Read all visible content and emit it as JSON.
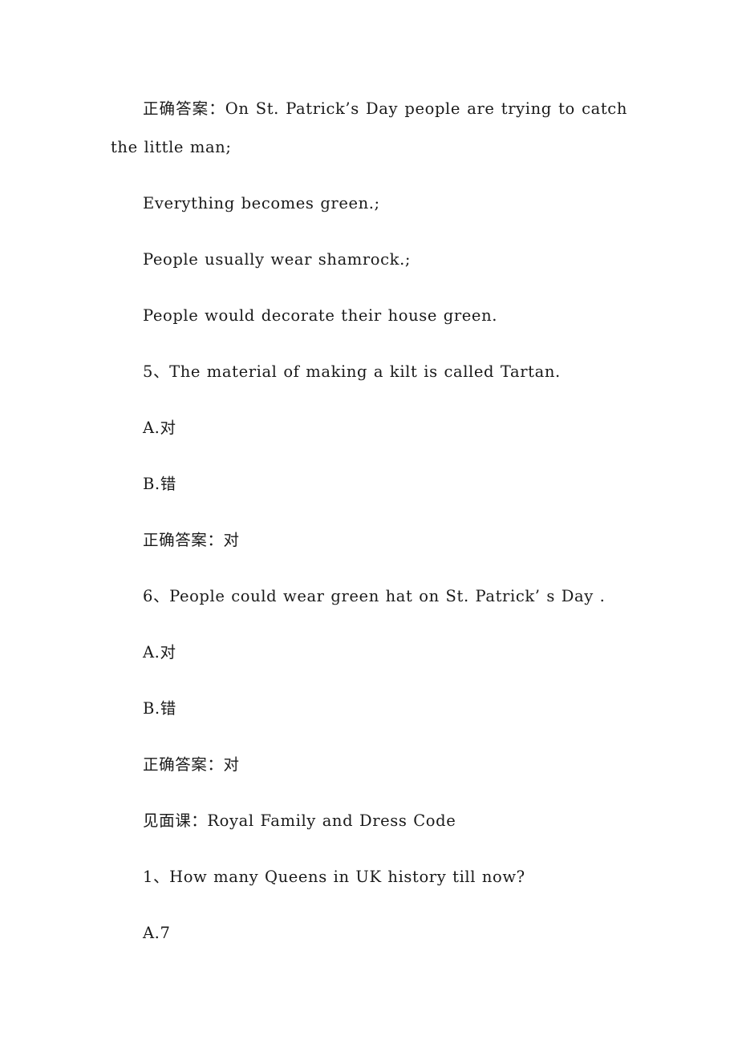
{
  "document": {
    "background_color": "#ffffff",
    "text_color": "#1a1a1a",
    "blocks": [
      {
        "id": "answer-4",
        "kind": "correct-answer",
        "text": "正确答案：On St. Patrick’s Day people are trying to catch the little man;"
      },
      {
        "id": "answer-4-line-2",
        "kind": "correct-answer-continuation",
        "text": "Everything becomes green.;"
      },
      {
        "id": "answer-4-line-3",
        "kind": "correct-answer-continuation",
        "text": "People usually wear shamrock.;"
      },
      {
        "id": "answer-4-line-4",
        "kind": "correct-answer-continuation",
        "text": "People would decorate their house green."
      },
      {
        "id": "question-5",
        "kind": "question",
        "text": "5、The material of making a kilt is called Tartan."
      },
      {
        "id": "question-5-option-a",
        "kind": "option",
        "text": "A.对"
      },
      {
        "id": "question-5-option-b",
        "kind": "option",
        "text": "B.错"
      },
      {
        "id": "question-5-answer",
        "kind": "correct-answer",
        "text": "正确答案：对"
      },
      {
        "id": "question-6",
        "kind": "question",
        "text": "6、People could wear green hat on St. Patrick’ s Day ."
      },
      {
        "id": "question-6-option-a",
        "kind": "option",
        "text": "A.对"
      },
      {
        "id": "question-6-option-b",
        "kind": "option",
        "text": "B.错"
      },
      {
        "id": "question-6-answer",
        "kind": "correct-answer",
        "text": "正确答案：对"
      },
      {
        "id": "section-heading",
        "kind": "section-heading",
        "text": "见面课：Royal Family and Dress Code"
      },
      {
        "id": "question-1",
        "kind": "question",
        "text": "1、How many Queens in UK history till now?"
      },
      {
        "id": "question-1-option-a",
        "kind": "option",
        "text": "A.7"
      }
    ]
  }
}
